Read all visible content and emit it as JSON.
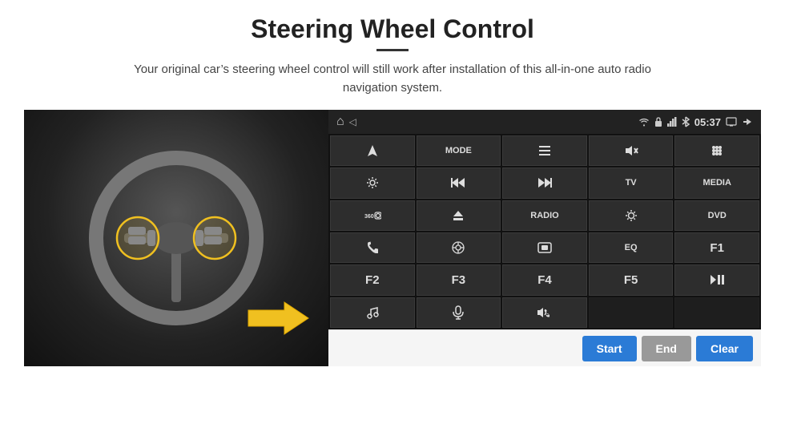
{
  "header": {
    "title": "Steering Wheel Control",
    "subtitle": "Your original car’s steering wheel control will still work after installation of this all-in-one auto radio navigation system."
  },
  "statusbar": {
    "time": "05:37",
    "home_icon": "⌂",
    "wifi_icon": "□",
    "battery_icon": "□",
    "bluetooth_icon": "□"
  },
  "grid_buttons": [
    {
      "id": "nav",
      "label": "",
      "icon": "navigation",
      "row": 1,
      "col": 1
    },
    {
      "id": "mode",
      "label": "MODE",
      "icon": "",
      "row": 1,
      "col": 2
    },
    {
      "id": "menu",
      "label": "",
      "icon": "menu",
      "row": 1,
      "col": 3
    },
    {
      "id": "mute",
      "label": "",
      "icon": "mute",
      "row": 1,
      "col": 4
    },
    {
      "id": "apps",
      "label": "",
      "icon": "apps",
      "row": 1,
      "col": 5
    },
    {
      "id": "settings",
      "label": "",
      "icon": "settings",
      "row": 2,
      "col": 1
    },
    {
      "id": "prev",
      "label": "",
      "icon": "prev",
      "row": 2,
      "col": 2
    },
    {
      "id": "next",
      "label": "",
      "icon": "next",
      "row": 2,
      "col": 3
    },
    {
      "id": "tv",
      "label": "TV",
      "icon": "",
      "row": 2,
      "col": 4
    },
    {
      "id": "media",
      "label": "MEDIA",
      "icon": "",
      "row": 2,
      "col": 5
    },
    {
      "id": "camera360",
      "label": "",
      "icon": "360cam",
      "row": 3,
      "col": 1
    },
    {
      "id": "eject",
      "label": "",
      "icon": "eject",
      "row": 3,
      "col": 2
    },
    {
      "id": "radio",
      "label": "RADIO",
      "icon": "",
      "row": 3,
      "col": 3
    },
    {
      "id": "brightness",
      "label": "",
      "icon": "brightness",
      "row": 3,
      "col": 4
    },
    {
      "id": "dvd",
      "label": "DVD",
      "icon": "",
      "row": 3,
      "col": 5
    },
    {
      "id": "phone",
      "label": "",
      "icon": "phone",
      "row": 4,
      "col": 1
    },
    {
      "id": "navi",
      "label": "",
      "icon": "navi",
      "row": 4,
      "col": 2
    },
    {
      "id": "screen",
      "label": "",
      "icon": "screen",
      "row": 4,
      "col": 3
    },
    {
      "id": "eq",
      "label": "EQ",
      "icon": "",
      "row": 4,
      "col": 4
    },
    {
      "id": "f1",
      "label": "F1",
      "icon": "",
      "row": 4,
      "col": 5
    },
    {
      "id": "f2",
      "label": "F2",
      "icon": "",
      "row": 5,
      "col": 1
    },
    {
      "id": "f3",
      "label": "F3",
      "icon": "",
      "row": 5,
      "col": 2
    },
    {
      "id": "f4",
      "label": "F4",
      "icon": "",
      "row": 5,
      "col": 3
    },
    {
      "id": "f5",
      "label": "F5",
      "icon": "",
      "row": 5,
      "col": 4
    },
    {
      "id": "playpause",
      "label": "",
      "icon": "playpause",
      "row": 5,
      "col": 5
    },
    {
      "id": "music",
      "label": "",
      "icon": "music",
      "row": 6,
      "col": 1
    },
    {
      "id": "mic",
      "label": "",
      "icon": "mic",
      "row": 6,
      "col": 2
    },
    {
      "id": "handsfree",
      "label": "",
      "icon": "handsfree",
      "row": 6,
      "col": 3,
      "span": 1
    }
  ],
  "action_bar": {
    "start_label": "Start",
    "end_label": "End",
    "clear_label": "Clear"
  }
}
